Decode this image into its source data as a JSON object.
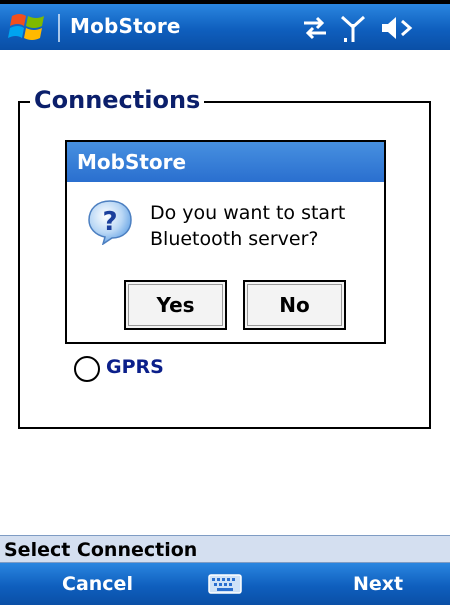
{
  "titlebar": {
    "app_title": "MobStore",
    "icons": [
      "windows-start-icon",
      "connectivity-icon",
      "signal-icon",
      "volume-icon"
    ]
  },
  "group": {
    "legend": "Connections",
    "radio_options": [
      {
        "label": "GPRS",
        "selected": false
      }
    ]
  },
  "dialog": {
    "title": "MobStore",
    "icon": "question-icon",
    "message": "Do you want to start Bluetooth server?",
    "yes_label": "Yes",
    "no_label": "No"
  },
  "bottom": {
    "select_label": "Select Connection",
    "left_softkey": "Cancel",
    "right_softkey": "Next",
    "center_icon": "keyboard-icon"
  },
  "colors": {
    "titlebar_blue": "#0f5fbe",
    "dialog_title_blue": "#2a6fcf",
    "legend_text": "#0b1f6b",
    "select_bar": "#d4dff0"
  }
}
